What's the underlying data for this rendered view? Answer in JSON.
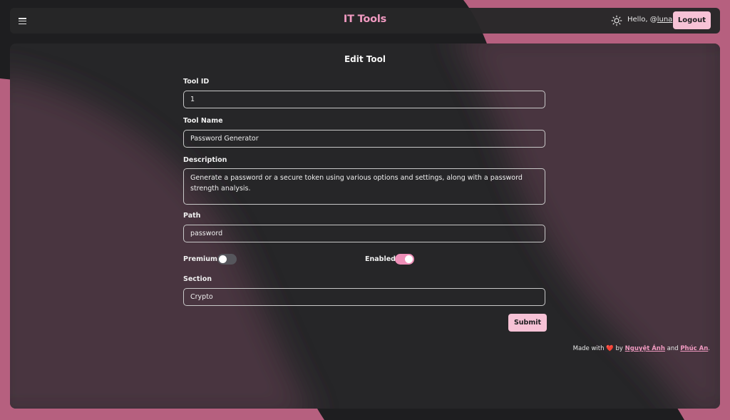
{
  "header": {
    "app_title": "IT Tools",
    "greeting_prefix": "Hello, @",
    "username": "luna",
    "logout_label": "Logout"
  },
  "form": {
    "title": "Edit Tool",
    "tool_id": {
      "label": "Tool ID",
      "value": "1"
    },
    "tool_name": {
      "label": "Tool Name",
      "value": "Password Generator"
    },
    "description": {
      "label": "Description",
      "value": "Generate a password or a secure token using various options and settings, along with a password strength analysis."
    },
    "path": {
      "label": "Path",
      "value": "password"
    },
    "premium": {
      "label": "Premium",
      "checked": false
    },
    "enabled": {
      "label": "Enabled",
      "checked": true
    },
    "section": {
      "label": "Section",
      "value": "Crypto"
    },
    "submit_label": "Submit"
  },
  "footer": {
    "made_with": "Made with",
    "heart": "❤️",
    "by": "by",
    "author1": "Nguyệt Ánh",
    "and": "and",
    "author2": "Phúc An",
    "end": "."
  },
  "colors": {
    "accent": "#f19ac1",
    "button_bg": "#f7c2d6",
    "background": "#1e1e20",
    "pink_wave": "#b6607f"
  },
  "icons": {
    "menu": "menu-icon",
    "theme": "sun-icon"
  }
}
